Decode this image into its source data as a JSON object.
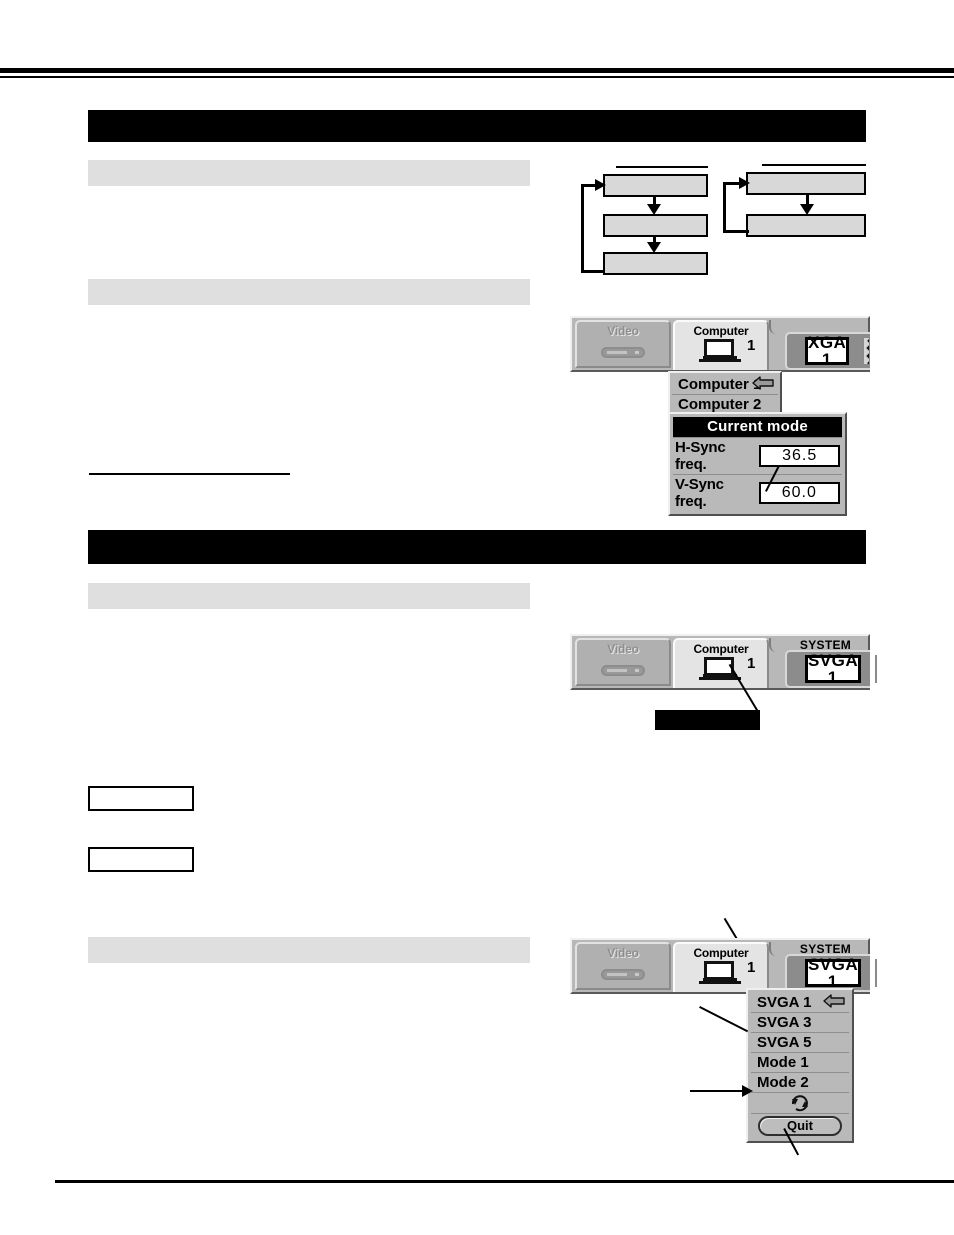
{
  "document": {
    "type": "projector-manual-page",
    "background": "#ffffff"
  },
  "sections": [
    {
      "id": "section-1",
      "heading_bar": {
        "text": "",
        "color": "#000000"
      },
      "subheads": [
        {
          "text": "",
          "color": "#dfdfdf"
        },
        {
          "text": "",
          "color": "#dfdfdf"
        }
      ]
    },
    {
      "id": "section-2",
      "heading_bar": {
        "text": "",
        "color": "#000000"
      },
      "subheads": [
        {
          "text": "",
          "color": "#dfdfdf"
        },
        {
          "text": "",
          "color": "#dfdfdf"
        }
      ]
    }
  ],
  "flow_diagrams": [
    {
      "name": "flow-three-step",
      "boxes": [
        {
          "label": ""
        },
        {
          "label": ""
        },
        {
          "label": ""
        }
      ],
      "loop_back": true
    },
    {
      "name": "flow-two-step",
      "boxes": [
        {
          "label": ""
        },
        {
          "label": ""
        }
      ],
      "loop_back": true
    }
  ],
  "osd_panel_1": {
    "name": "system-menu-computer1",
    "tabs": [
      {
        "label": "Video",
        "icon": "video-deck-icon",
        "selected": false
      },
      {
        "label": "Computer",
        "icon": "laptop-icon",
        "number": "1",
        "selected": true
      }
    ],
    "system_label": "",
    "value": "XGA 1",
    "right_icon": "zigzag-pattern-icon",
    "source_menu": {
      "items": [
        {
          "label": "Computer 1",
          "pointer": true
        },
        {
          "label": "Computer 2",
          "pointer": false
        }
      ]
    },
    "current_mode": {
      "title": "Current mode",
      "rows": [
        {
          "key": "H-Sync freq.",
          "value": "36.5"
        },
        {
          "key": "V-Sync freq.",
          "value": "60.0"
        }
      ]
    }
  },
  "osd_panel_2": {
    "name": "system-menu-svga1",
    "tabs": [
      {
        "label": "Video",
        "icon": "video-deck-icon",
        "selected": false
      },
      {
        "label": "Computer",
        "icon": "laptop-icon",
        "number": "1",
        "selected": true
      }
    ],
    "system_label": "SYSTEM",
    "value": "SVGA 1",
    "right_icon": "zigzag-pattern-icon",
    "callout": {
      "text": "",
      "color": "#000000"
    }
  },
  "osd_panel_3": {
    "name": "system-menu-svga-dropdown",
    "tabs": [
      {
        "label": "Video",
        "icon": "video-deck-icon",
        "selected": false
      },
      {
        "label": "Computer",
        "icon": "laptop-icon",
        "number": "1",
        "selected": true
      }
    ],
    "system_label": "SYSTEM",
    "value": "SVGA 1",
    "right_icon": "zigzag-pattern-icon",
    "dropdown": {
      "items": [
        {
          "label": "SVGA 1",
          "pointer": true,
          "icon": null
        },
        {
          "label": "SVGA 3",
          "pointer": false,
          "icon": null
        },
        {
          "label": "SVGA 5",
          "pointer": false,
          "icon": null
        },
        {
          "label": "Mode  1",
          "pointer": false,
          "icon": null
        },
        {
          "label": "Mode  2",
          "pointer": false,
          "icon": null
        },
        {
          "label": "",
          "pointer": false,
          "icon": "auto-cycle-icon"
        }
      ],
      "quit_label": "Quit"
    }
  },
  "colors": {
    "osd_body": "#b8b8b8",
    "osd_field": "#8c8c8c",
    "flow_box": "#d8d8d8",
    "subhead": "#dfdfdf",
    "heading": "#000000"
  }
}
